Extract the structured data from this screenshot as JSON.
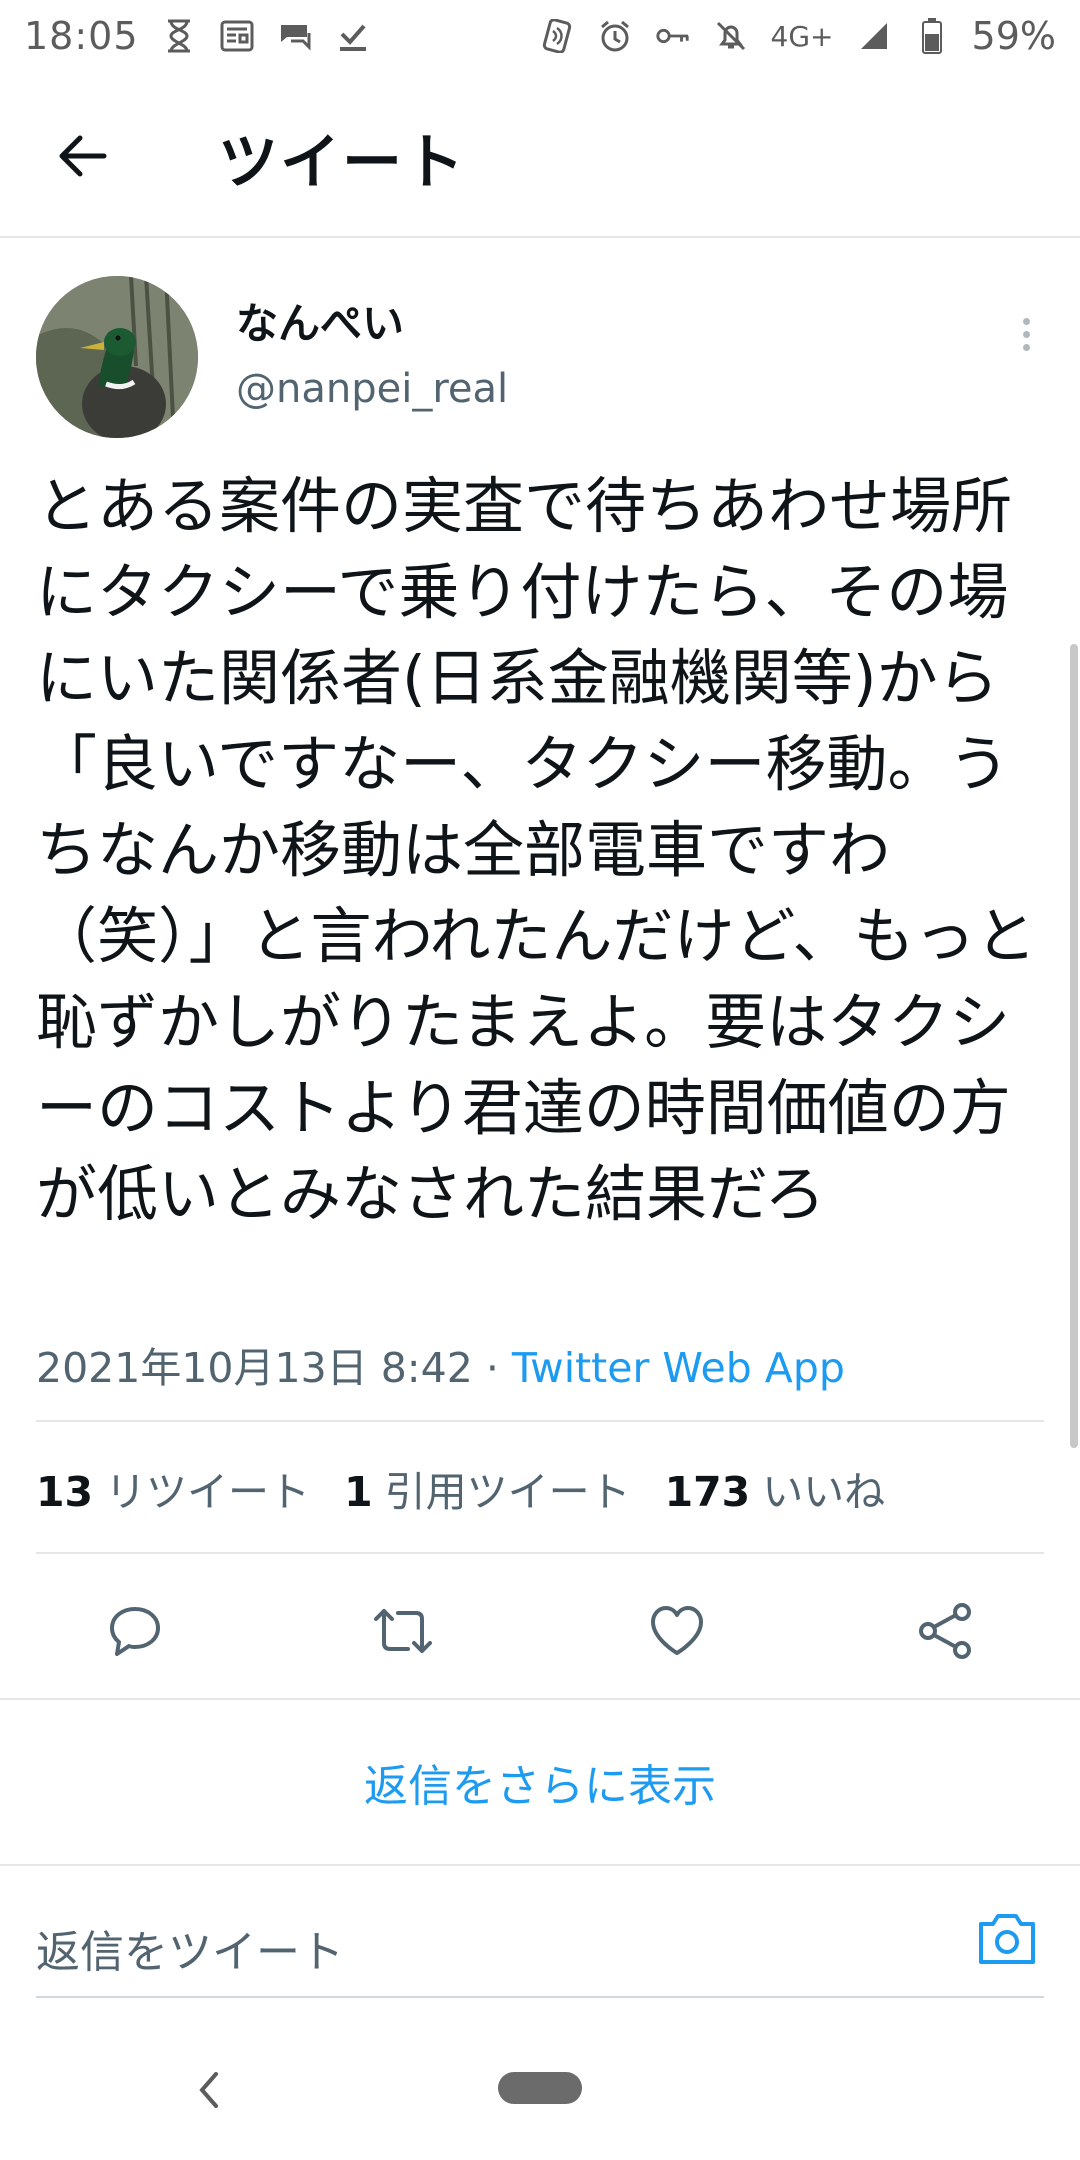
{
  "status_bar": {
    "time": "18:05",
    "network": "4G+",
    "battery": "59%",
    "left_icons": [
      "hourglass-icon",
      "news-icon",
      "messenger-icon",
      "download-done-icon"
    ],
    "right_icons": [
      "nfc-icon",
      "alarm-icon",
      "key-icon",
      "bell-off-icon",
      "signal-icon",
      "battery-icon"
    ]
  },
  "header": {
    "title": "ツイート"
  },
  "tweet": {
    "display_name": "なんぺい",
    "handle": "@nanpei_real",
    "text": "とある案件の実査で待ちあわせ場所にタクシーで乗り付けたら、その場にいた関係者(日系金融機関等)から「良いですなー、タクシー移動。うちなんか移動は全部電車ですわ（笑）」と言われたんだけど、もっと恥ずかしがりたまえよ。要はタクシーのコストより君達の時間価値の方が低いとみなされた結果だろ",
    "timestamp": "2021年10月13日 8:42",
    "separator": " · ",
    "source": "Twitter Web App"
  },
  "stats": {
    "retweets_count": "13",
    "retweets_label": "リツイート",
    "quotes_count": "1",
    "quotes_label": "引用ツイート",
    "likes_count": "173",
    "likes_label": "いいね"
  },
  "more_replies": "返信をさらに表示",
  "reply": {
    "placeholder": "返信をツイート"
  },
  "colors": {
    "accent": "#1d9bf0",
    "text": "#0f1419",
    "secondary": "#536471",
    "divider": "#e6e6e6"
  }
}
